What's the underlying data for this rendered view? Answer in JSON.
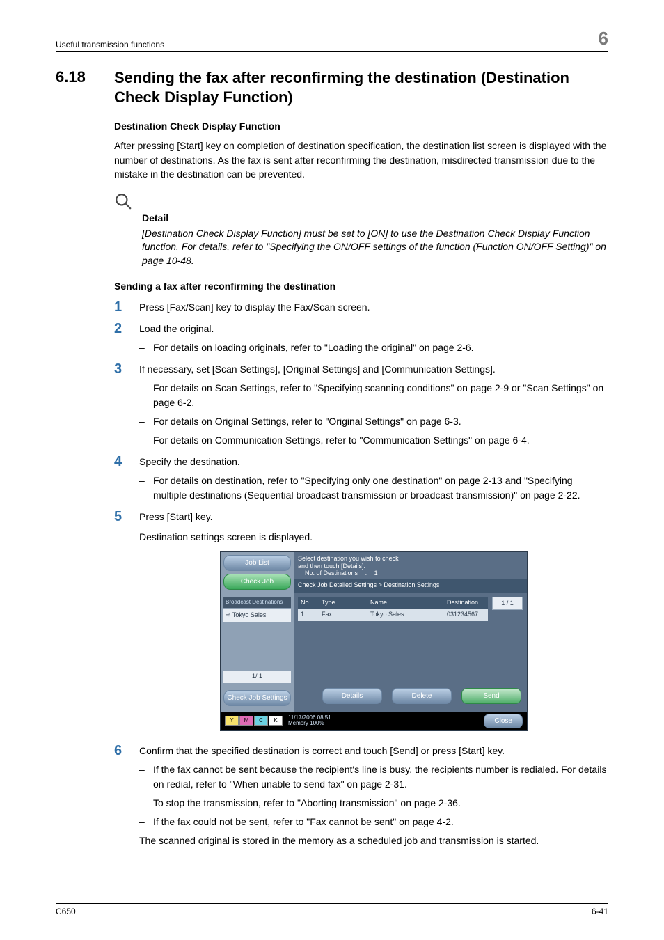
{
  "running_head": {
    "left": "Useful transmission functions",
    "right": "6"
  },
  "section": {
    "number": "6.18",
    "title": "Sending the fax after reconfirming the destination (Destination Check Display Function)"
  },
  "h4_1": "Destination Check Display Function",
  "intro": "After pressing [Start] key on completion of destination specification, the destination list screen is displayed with the number of destinations. As the fax is sent after reconfirming the destination, misdirected transmission due to the mistake in the destination can be prevented.",
  "detail": {
    "label": "Detail",
    "text": "[Destination Check Display Function] must be set to [ON] to use the Destination Check Display Function function. For details, refer to \"Specifying the ON/OFF settings of the function (Function ON/OFF Setting)\" on page 10-48."
  },
  "h4_2": "Sending a fax after reconfirming the destination",
  "steps": {
    "s1": {
      "num": "1",
      "text": "Press [Fax/Scan] key to display the Fax/Scan screen."
    },
    "s2": {
      "num": "2",
      "text": "Load the original.",
      "sub1": "For details on loading originals, refer to \"Loading the original\" on page 2-6."
    },
    "s3": {
      "num": "3",
      "text": "If necessary, set [Scan Settings], [Original Settings] and [Communication Settings].",
      "sub1": "For details on Scan Settings, refer to \"Specifying scanning conditions\" on page 2-9 or \"Scan Settings\" on page 6-2.",
      "sub2": "For details on Original Settings, refer to \"Original Settings\" on page 6-3.",
      "sub3": "For details on Communication Settings, refer to \"Communication Settings\" on page 6-4."
    },
    "s4": {
      "num": "4",
      "text": "Specify the destination.",
      "sub1": "For details on destination, refer to \"Specifying only one destination\" on page 2-13 and \"Specifying multiple destinations (Sequential broadcast transmission or broadcast transmission)\" on page 2-22."
    },
    "s5": {
      "num": "5",
      "text": "Press [Start] key.",
      "after": "Destination settings screen is displayed."
    },
    "s6": {
      "num": "6",
      "text": "Confirm that the specified destination is correct and touch [Send] or press [Start] key.",
      "sub1": "If the fax cannot be sent because the recipient's line is busy, the recipients number is redialed. For details on redial, refer to \"When unable to send fax\" on page 2-31.",
      "sub2": "To stop the transmission, refer to \"Aborting transmission\" on page 2-36.",
      "sub3": "If the fax could not be sent, refer to \"Fax cannot be sent\" on page 4-2.",
      "after": "The scanned original is stored in the memory as a scheduled job and transmission is started."
    }
  },
  "mock": {
    "job_list": "Job List",
    "check_job": "Check Job",
    "msg_line1": "Select destination you wish to check",
    "msg_line2": "and then touch [Details].",
    "msg_line3_label": "No. of Destinations",
    "msg_line3_sep": ":",
    "msg_line3_val": "1",
    "breadcrumb": "Check Job Detailed Settings > Destination Settings",
    "left_label": "Broadcast Destinations",
    "left_item": "⇨ Tokyo Sales",
    "left_page": "1/   1",
    "check_job_settings": "Check Job Settings",
    "th_no": "No.",
    "th_type": "Type",
    "th_name": "Name",
    "th_dest": "Destination",
    "r_no": "1",
    "r_type": "Fax",
    "r_name": "Tokyo Sales",
    "r_dest": "031234567",
    "page_right": "1 / 1",
    "btn_details": "Details",
    "btn_delete": "Delete",
    "btn_send": "Send",
    "btn_close": "Close",
    "toner_y": "Y",
    "toner_m": "M",
    "toner_c": "C",
    "toner_k": "K",
    "dt_line1": "11/17/2006    08:51",
    "dt_line2": "Memory        100%"
  },
  "footer": {
    "left": "C650",
    "right": "6-41"
  }
}
